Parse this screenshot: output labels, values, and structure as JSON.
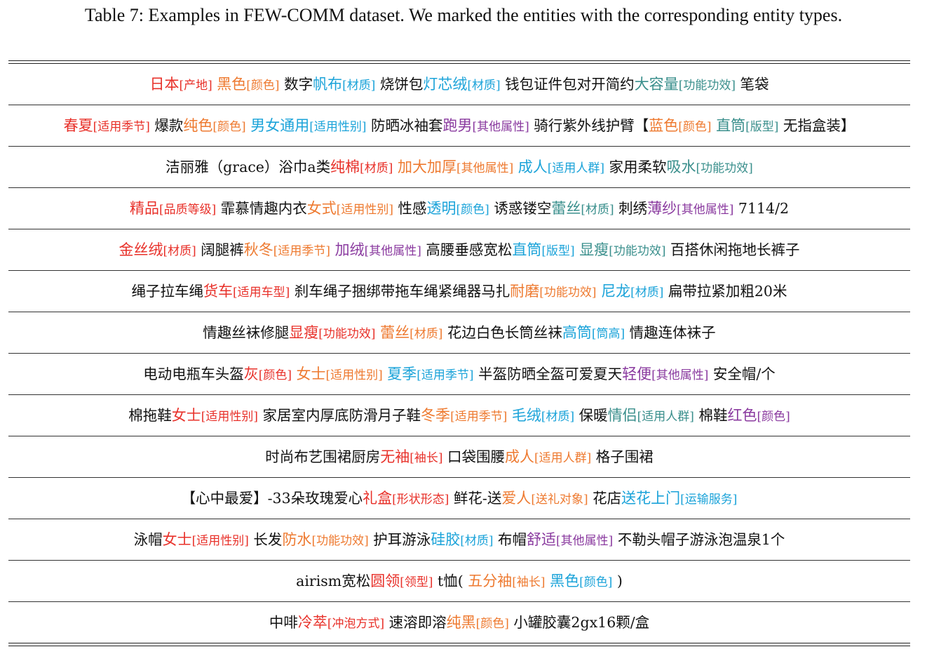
{
  "caption": "Table 7: Examples in FEW-COMM dataset. We marked the entities with the corresponding entity types.",
  "colors": {
    "red": "#e8312a",
    "orange": "#ee7a30",
    "blue": "#1ba3d9",
    "teal": "#3a8f8c",
    "purple": "#8a3a9f"
  },
  "rows": [
    [
      {
        "e": "日本",
        "t": "[产地]",
        "c": "red"
      },
      {
        "e": " "
      },
      {
        "e": "黑色",
        "t": "[颜色]",
        "c": "orange"
      },
      {
        "e": " 数字"
      },
      {
        "e": "帆布",
        "t": "[材质]",
        "c": "blue"
      },
      {
        "e": " 烧饼包"
      },
      {
        "e": "灯芯绒",
        "t": "[材质]",
        "c": "blue"
      },
      {
        "e": " 钱包证件包对开简约"
      },
      {
        "e": "大容量",
        "t": "[功能功效]",
        "c": "teal"
      },
      {
        "e": " 笔袋"
      }
    ],
    [
      {
        "e": "春夏",
        "t": "[适用季节]",
        "c": "red"
      },
      {
        "e": " 爆款"
      },
      {
        "e": "纯色",
        "t": "[颜色]",
        "c": "orange"
      },
      {
        "e": " "
      },
      {
        "e": "男女通用",
        "t": "[适用性别]",
        "c": "blue"
      },
      {
        "e": " 防晒冰袖套"
      },
      {
        "e": "跑男",
        "t": "[其他属性]",
        "c": "purple"
      },
      {
        "e": " 骑行紫外线护臂【"
      },
      {
        "e": "蓝色",
        "t": "[颜色]",
        "c": "orange"
      },
      {
        "e": " "
      },
      {
        "e": "直筒",
        "t": "[版型]",
        "c": "teal"
      },
      {
        "e": " 无指盒装】"
      }
    ],
    [
      {
        "e": "洁丽雅（grace）浴巾a类"
      },
      {
        "e": "纯棉",
        "t": "[材质]",
        "c": "red"
      },
      {
        "e": " "
      },
      {
        "e": "加大加厚",
        "t": "[其他属性]",
        "c": "orange"
      },
      {
        "e": " "
      },
      {
        "e": "成人",
        "t": "[适用人群]",
        "c": "blue"
      },
      {
        "e": " 家用柔软"
      },
      {
        "e": "吸水",
        "t": "[功能功效]",
        "c": "teal"
      }
    ],
    [
      {
        "e": "精品",
        "t": "[品质等级]",
        "c": "red"
      },
      {
        "e": " 霏慕情趣内衣"
      },
      {
        "e": "女式",
        "t": "[适用性别]",
        "c": "orange"
      },
      {
        "e": " 性感"
      },
      {
        "e": "透明",
        "t": "[颜色]",
        "c": "blue"
      },
      {
        "e": " 诱惑镂空"
      },
      {
        "e": "蕾丝",
        "t": "[材质]",
        "c": "teal"
      },
      {
        "e": " 刺绣"
      },
      {
        "e": "薄纱",
        "t": "[其他属性]",
        "c": "purple"
      },
      {
        "e": " 7114/2"
      }
    ],
    [
      {
        "e": "金丝绒",
        "t": "[材质]",
        "c": "red"
      },
      {
        "e": " 阔腿裤"
      },
      {
        "e": "秋冬",
        "t": "[适用季节]",
        "c": "orange"
      },
      {
        "e": " "
      },
      {
        "e": "加绒",
        "t": "[其他属性]",
        "c": "purple"
      },
      {
        "e": " 高腰垂感宽松"
      },
      {
        "e": "直筒",
        "t": "[版型]",
        "c": "blue"
      },
      {
        "e": " "
      },
      {
        "e": "显瘦",
        "t": "[功能功效]",
        "c": "teal"
      },
      {
        "e": " 百搭休闲拖地长裤子"
      }
    ],
    [
      {
        "e": "绳子拉车绳"
      },
      {
        "e": "货车",
        "t": "[适用车型]",
        "c": "red"
      },
      {
        "e": " 刹车绳子捆绑带拖车绳紧绳器马扎"
      },
      {
        "e": "耐磨",
        "t": "[功能功效]",
        "c": "orange"
      },
      {
        "e": " "
      },
      {
        "e": "尼龙",
        "t": "[材质]",
        "c": "blue"
      },
      {
        "e": " 扁带拉紧加粗20米"
      }
    ],
    [
      {
        "e": "情趣丝袜修腿"
      },
      {
        "e": "显瘦",
        "t": "[功能功效]",
        "c": "red"
      },
      {
        "e": " "
      },
      {
        "e": "蕾丝",
        "t": "[材质]",
        "c": "orange"
      },
      {
        "e": " 花边白色长筒丝袜"
      },
      {
        "e": "高筒",
        "t": "[筒高]",
        "c": "blue"
      },
      {
        "e": " 情趣连体袜子"
      }
    ],
    [
      {
        "e": "电动电瓶车头盔"
      },
      {
        "e": "灰",
        "t": "[颜色]",
        "c": "red"
      },
      {
        "e": " "
      },
      {
        "e": "女士",
        "t": "[适用性别]",
        "c": "orange"
      },
      {
        "e": " "
      },
      {
        "e": "夏季",
        "t": "[适用季节]",
        "c": "blue"
      },
      {
        "e": " 半盔防晒全盔可爱夏天"
      },
      {
        "e": "轻便",
        "t": "[其他属性]",
        "c": "purple"
      },
      {
        "e": " 安全帽/个"
      }
    ],
    [
      {
        "e": "棉拖鞋"
      },
      {
        "e": "女士",
        "t": "[适用性别]",
        "c": "red"
      },
      {
        "e": " 家居室内厚底防滑月子鞋"
      },
      {
        "e": "冬季",
        "t": "[适用季节]",
        "c": "orange"
      },
      {
        "e": " "
      },
      {
        "e": "毛绒",
        "t": "[材质]",
        "c": "blue"
      },
      {
        "e": " 保暖"
      },
      {
        "e": "情侣",
        "t": "[适用人群]",
        "c": "teal"
      },
      {
        "e": " 棉鞋"
      },
      {
        "e": "红色",
        "t": "[颜色]",
        "c": "purple"
      }
    ],
    [
      {
        "e": "时尚布艺围裙厨房"
      },
      {
        "e": "无袖",
        "t": "[袖长]",
        "c": "red"
      },
      {
        "e": " 口袋围腰"
      },
      {
        "e": "成人",
        "t": "[适用人群]",
        "c": "orange"
      },
      {
        "e": " 格子围裙"
      }
    ],
    [
      {
        "e": "【心中最爱】-33朵玫瑰爱心"
      },
      {
        "e": "礼盒",
        "t": "[形状形态]",
        "c": "red"
      },
      {
        "e": " 鲜花-送"
      },
      {
        "e": "爱人",
        "t": "[送礼对象]",
        "c": "orange"
      },
      {
        "e": " 花店"
      },
      {
        "e": "送花上门",
        "t": "[运输服务]",
        "c": "blue"
      }
    ],
    [
      {
        "e": "泳帽"
      },
      {
        "e": "女士",
        "t": "[适用性别]",
        "c": "red"
      },
      {
        "e": " 长发"
      },
      {
        "e": "防水",
        "t": "[功能功效]",
        "c": "orange"
      },
      {
        "e": " 护耳游泳"
      },
      {
        "e": "硅胶",
        "t": "[材质]",
        "c": "blue"
      },
      {
        "e": " 布帽"
      },
      {
        "e": "舒适",
        "t": "[其他属性]",
        "c": "purple"
      },
      {
        "e": " 不勒头帽子游泳泡温泉1个"
      }
    ],
    [
      {
        "e": "airism宽松"
      },
      {
        "e": "圆领",
        "t": "[领型]",
        "c": "red"
      },
      {
        "e": " t恤( "
      },
      {
        "e": "五分袖",
        "t": "[袖长]",
        "c": "orange"
      },
      {
        "e": " "
      },
      {
        "e": "黑色",
        "t": "[颜色]",
        "c": "blue"
      },
      {
        "e": " )"
      }
    ],
    [
      {
        "e": "中啡"
      },
      {
        "e": "冷萃",
        "t": "[冲泡方式]",
        "c": "red"
      },
      {
        "e": " 速溶即溶"
      },
      {
        "e": "纯黑",
        "t": "[颜色]",
        "c": "orange"
      },
      {
        "e": " 小罐胶囊2gx16颗/盒"
      }
    ]
  ]
}
